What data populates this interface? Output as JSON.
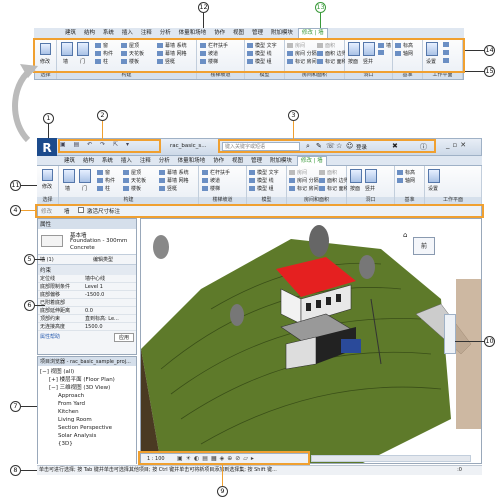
{
  "callouts": {
    "c1": "1",
    "c2": "2",
    "c3": "3",
    "c4": "4",
    "c5": "5",
    "c6": "6",
    "c7": "7",
    "c8": "8",
    "c9": "9",
    "c10": "10",
    "c11": "11",
    "c12": "12",
    "c13": "13",
    "c14": "14",
    "c15": "15"
  },
  "app": {
    "file_name": "rac_basic_s...",
    "search_placeholder": "键入关键字或短语",
    "signin": "登录",
    "logo_letter": "R"
  },
  "tabs": [
    "建筑",
    "结构",
    "系统",
    "插入",
    "注释",
    "分析",
    "体量和场地",
    "协作",
    "视图",
    "管理",
    "附加模块",
    "修改 | 墙"
  ],
  "ribbon": {
    "modify_label": "修改",
    "items": {
      "wall": "墙",
      "door": "门",
      "window": "窗",
      "component": "构件",
      "column": "柱",
      "roof": "屋顶",
      "ceiling": "天花板",
      "floor": "楼板",
      "curtain_system": "幕墙 系统",
      "curtain_grid": "幕墙 网格",
      "mullion": "竖梃",
      "railing": "栏杆扶手",
      "ramp": "坡道",
      "stair": "楼梯",
      "model_text": "模型 文字",
      "model_line": "模型 线",
      "model_group": "模型 组",
      "room": "房间",
      "room_separator": "房间 分隔",
      "tag_room": "标记 房间",
      "area": "面积",
      "area_boundary": "面积 边界",
      "tag_area": "标记 面积",
      "by_face": "按面",
      "shaft": "竖井",
      "wall_opening": "墙",
      "vertical": "垂直",
      "dormer": "老虎窗",
      "level": "标高",
      "grid": "轴网",
      "set": "设置",
      "show": "显示",
      "ref_plane": "参照 平面",
      "viewer": "查看器"
    },
    "panels": [
      "选择",
      "构建",
      "楼梯坡道",
      "模型",
      "房间和面积",
      "洞口",
      "基准",
      "工作平面"
    ]
  },
  "options_bar": {
    "modify_label": "修改",
    "wall_label": "墙",
    "activate_dims": "激活尺寸标注"
  },
  "properties": {
    "header": "属性",
    "type_family": "基本墙",
    "type_name": "Foundation - 300mm",
    "type_sub": "Concrete",
    "instance_selector": "墙 (1)",
    "edit_type": "编辑类型",
    "section": "约束",
    "rows": [
      {
        "k": "定位线",
        "v": "墙中心线"
      },
      {
        "k": "底部限制条件",
        "v": "Level 1"
      },
      {
        "k": "底部偏移",
        "v": "-1500.0"
      },
      {
        "k": "已附着底部",
        "v": ""
      },
      {
        "k": "底部延伸距离",
        "v": "0.0"
      },
      {
        "k": "顶部约束",
        "v": "直到标高: Le..."
      },
      {
        "k": "无连接高度",
        "v": "1500.0"
      }
    ],
    "help_link": "属性帮助",
    "apply_button": "应用"
  },
  "browser": {
    "header": "项目浏览器 - rac_basic_sample_proj...",
    "items": [
      {
        "label": "视图 (all)",
        "level": 0,
        "sign": "−"
      },
      {
        "label": "楼层平面 (Floor Plan)",
        "level": 1,
        "sign": "+"
      },
      {
        "label": "三维视图 (3D View)",
        "level": 1,
        "sign": "−"
      },
      {
        "label": "Approach",
        "level": 2,
        "sign": ""
      },
      {
        "label": "From Yard",
        "level": 2,
        "sign": ""
      },
      {
        "label": "Kitchen",
        "level": 2,
        "sign": ""
      },
      {
        "label": "Living Room",
        "level": 2,
        "sign": ""
      },
      {
        "label": "Section Perspective",
        "level": 2,
        "sign": ""
      },
      {
        "label": "Solar Analysis",
        "level": 2,
        "sign": ""
      },
      {
        "label": "{3D}",
        "level": 2,
        "sign": ""
      }
    ]
  },
  "viewcube": {
    "face": "前"
  },
  "view_control": {
    "scale": "1 : 100"
  },
  "status": {
    "text": "单击可进行选择; 按 Tab 键并单击可选择其他项目; 按 Ctrl 键并单击可将新项目添加到选择集; 按 Shift 键...",
    "zero": ":0"
  },
  "colors": {
    "orange": "#f0a030",
    "green": "#3a9a3a",
    "roof": "#e52020",
    "terrain": "#5e7a2a"
  }
}
